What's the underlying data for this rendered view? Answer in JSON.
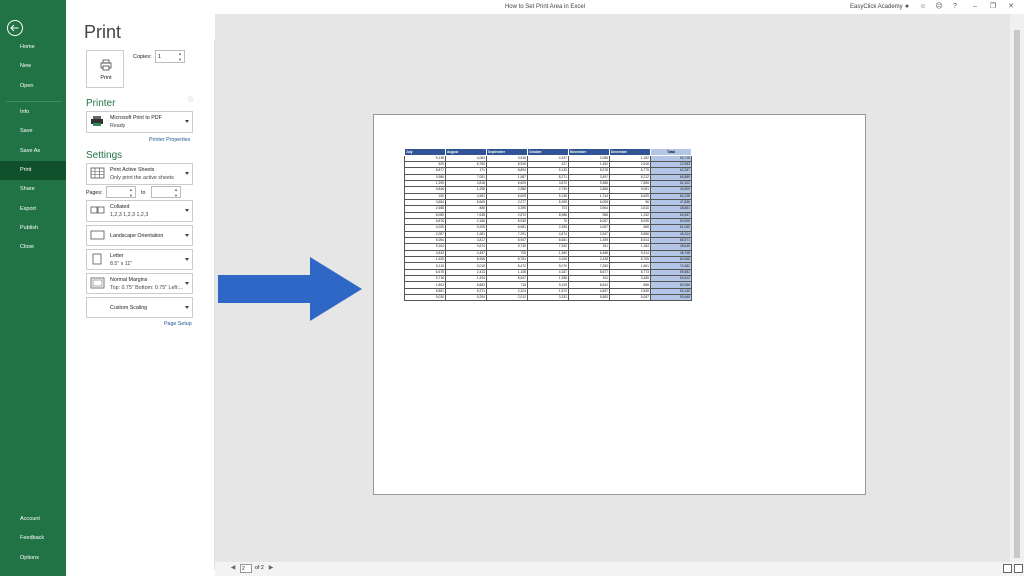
{
  "window": {
    "title": "How to Set Print Area in Excel",
    "user": "EasyClick Academy"
  },
  "nav": {
    "back": "back-arrow-icon",
    "top_items": [
      "Home",
      "New",
      "Open"
    ],
    "mid_items": [
      "Info",
      "Save",
      "Save As",
      "Print",
      "Share",
      "Export",
      "Publish",
      "Close"
    ],
    "selected": "Print",
    "bottom_items": [
      "Account",
      "Feedback",
      "Options"
    ]
  },
  "print": {
    "heading": "Print",
    "button_label": "Print",
    "copies_label": "Copies:",
    "copies_value": "1"
  },
  "printer": {
    "heading": "Printer",
    "name": "Microsoft Print to PDF",
    "status": "Ready",
    "properties_link": "Printer Properties"
  },
  "settings": {
    "heading": "Settings",
    "what": {
      "line1": "Print Active Sheets",
      "line2": "Only print the active sheets"
    },
    "pages_label": "Pages:",
    "to_label": "to",
    "collation": {
      "line1": "Collated",
      "line2": "1,2,3    1,2,3    1,2,3"
    },
    "orientation": {
      "line1": "Landscape Orientation"
    },
    "paper": {
      "line1": "Letter",
      "line2": "8.5\" x 11\""
    },
    "margins": {
      "line1": "Normal Margins",
      "line2": "Top: 0.75\" Bottom: 0.75\" Left:..."
    },
    "scaling": {
      "line1": "Custom Scaling"
    },
    "page_setup_link": "Page Setup"
  },
  "status": {
    "page_value": "2",
    "of_text": "of 2"
  },
  "sheet": {
    "headers": [
      "July",
      "August",
      "September",
      "October",
      "November",
      "December",
      "Total"
    ],
    "rows": [
      [
        "9,138",
        "4,084",
        "3,916",
        "4,937",
        "2,085",
        "1,182",
        "53,716"
      ],
      [
        "525",
        "8,750",
        "8,945",
        "427",
        "1,452",
        "2,616",
        "22,953"
      ],
      [
        "8,877",
        "171",
        "8,894",
        "5,133",
        "8,578",
        "8,779",
        "62,257"
      ],
      [
        "3,986",
        "7,081",
        "1,987",
        "8,271",
        "3,497",
        "8,212",
        "65,889"
      ],
      [
        "1,295",
        "3,818",
        "6,609",
        "3,870",
        "9,388",
        "7,855",
        "62,102"
      ],
      [
        "9,846",
        "1,258",
        "2,986",
        "2,739",
        "2,865",
        "9,061",
        "43,909"
      ],
      [
        "150",
        "4,551",
        "6,609",
        "5,136",
        "1,744",
        "5,625",
        "60,108"
      ],
      [
        "3,684",
        "5,669",
        "2,277",
        "8,395",
        "6,095",
        "96",
        "47,836"
      ],
      [
        "2,688",
        "886",
        "3,395",
        "703",
        "3,964",
        "4,510",
        "48,861"
      ],
      [
        "8,085",
        "7,638",
        "2,870",
        "8,988",
        "968",
        "1,232",
        "54,537"
      ],
      [
        "6,876",
        "2,186",
        "8,940",
        "70",
        "6,067",
        "8,935",
        "63,906"
      ],
      [
        "4,025",
        "9,205",
        "6,981",
        "2,395",
        "4,067",
        "665",
        "61,060"
      ],
      [
        "2,087",
        "1,981",
        "7,291",
        "4,874",
        "2,947",
        "5,858",
        "45,314"
      ],
      [
        "6,054",
        "3,817",
        "8,947",
        "6,681",
        "1,459",
        "8,514",
        "68,571"
      ],
      [
        "9,164",
        "3,674",
        "9,745",
        "7,252",
        "151",
        "1,184",
        "48,645"
      ],
      [
        "3,843",
        "4,497",
        "705",
        "1,360",
        "6,468",
        "9,314",
        "48,748"
      ],
      [
        "1,525",
        "8,906",
        "8,761",
        "3,106",
        "2,428",
        "8,765",
        "60,658"
      ],
      [
        "6,115",
        "3,015",
        "8,472",
        "9,070",
        "7,260",
        "1,661",
        "74,382"
      ],
      [
        "6,575",
        "2,413",
        "1,108",
        "4,187",
        "5,677",
        "8,773",
        "55,581"
      ],
      [
        "5,716",
        "1,324",
        "8,547",
        "1,358",
        "511",
        "3,465",
        "54,812"
      ],
      [
        "1,803",
        "8,883",
        "718",
        "9,125",
        "8,642",
        "858",
        "60,256"
      ],
      [
        "5,851",
        "9,271",
        "2,224",
        "1,572",
        "4,657",
        "2,545",
        "53,145"
      ],
      [
        "5,030",
        "9,294",
        "2,012",
        "3,332",
        "5,583",
        "5,067",
        "59,465"
      ]
    ]
  }
}
